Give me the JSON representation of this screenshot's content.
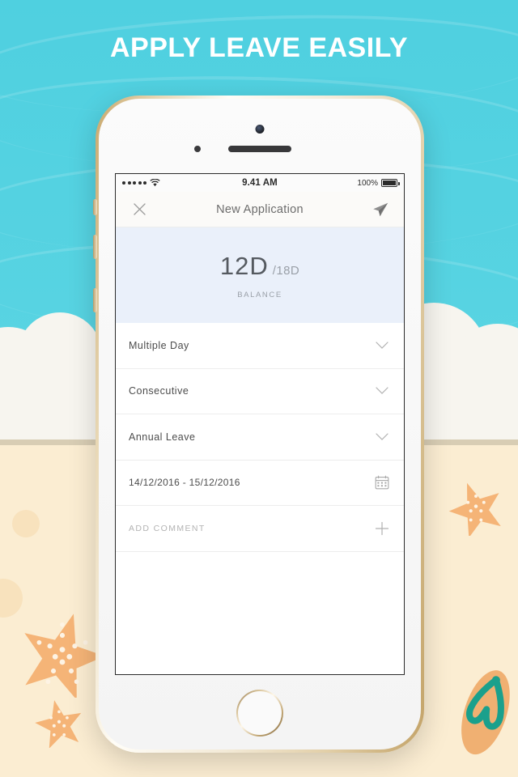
{
  "promo": {
    "headline": "APPLY LEAVE EASILY",
    "bg_color": "#52cfdf",
    "sand_color": "#fbedd2",
    "foam_color": "#f7f5ef"
  },
  "device": {
    "frame": "iphone-gold-white",
    "icons": {
      "camera": "front-camera",
      "speaker": "earpiece-speaker",
      "sensor": "proximity-sensor",
      "home": "home-button"
    }
  },
  "status_bar": {
    "signal_dots": 5,
    "wifi_icon": "wifi-icon",
    "time": "9.41 AM",
    "battery_percent": "100%",
    "battery_icon": "battery-full-icon"
  },
  "nav_bar": {
    "close_icon": "close-icon",
    "title": "New Application",
    "send_icon": "send-icon"
  },
  "balance": {
    "used": "12D",
    "total": "/18D",
    "label": "BALANCE",
    "bg_color": "#eaf0fa"
  },
  "form_rows": [
    {
      "label": "Multiple Day",
      "icon": "chevron-down-icon",
      "type": "select"
    },
    {
      "label": "Consecutive",
      "icon": "chevron-down-icon",
      "type": "select"
    },
    {
      "label": "Annual Leave",
      "icon": "chevron-down-icon",
      "type": "select"
    },
    {
      "label": "14/12/2016 - 15/12/2016",
      "icon": "calendar-icon",
      "type": "date-range"
    },
    {
      "label": "ADD COMMENT",
      "icon": "plus-icon",
      "type": "action"
    }
  ],
  "decorations": {
    "starfish_color": "#f5b477",
    "flipflop_sole": "#f0b072",
    "flipflop_strap": "#1aa08c"
  }
}
